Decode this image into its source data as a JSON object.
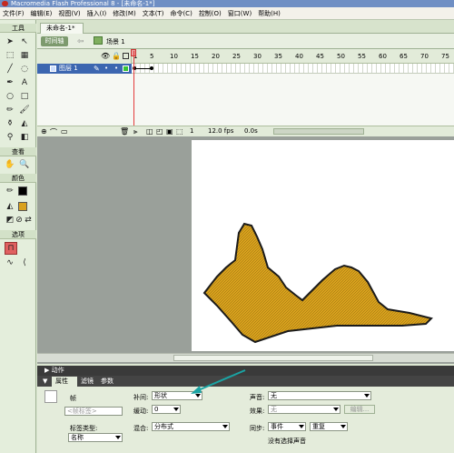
{
  "window": {
    "title": "Macromedia Flash Professional 8 - [未命名-1*]"
  },
  "menu": [
    "文件(F)",
    "编辑(E)",
    "视图(V)",
    "插入(I)",
    "修改(M)",
    "文本(T)",
    "命令(C)",
    "控制(O)",
    "窗口(W)",
    "帮助(H)"
  ],
  "tools_panel": {
    "title": "工具",
    "view_title": "查看",
    "colors_title": "颜色",
    "options_title": "选项"
  },
  "document": {
    "tab": "未命名-1*",
    "timeline_button": "时间轴",
    "scene": "场景 1"
  },
  "timeline": {
    "layer_name": "图层 1",
    "frame_numbers": [
      "1",
      "5",
      "10",
      "15",
      "20",
      "25",
      "30",
      "35",
      "40",
      "45",
      "50",
      "55",
      "60",
      "65",
      "70",
      "75"
    ],
    "current_frame": "1",
    "fps": "12.0 fps",
    "time": "0.0s"
  },
  "stage": {
    "shape_fill": "#d9a11d",
    "shape_stroke": "#1a1a1a"
  },
  "panels": {
    "actions": "动作",
    "properties": "属性",
    "filters": "滤镜",
    "parameters": "参数"
  },
  "properties": {
    "frame_label": "帧",
    "frame_label_placeholder": "<帧标签>",
    "label_type_label": "标签类型:",
    "label_type_value": "名称",
    "tween_label": "补间:",
    "tween_value": "形状",
    "ease_label": "缓动:",
    "ease_value": "0",
    "blend_label": "混合:",
    "blend_value": "分布式",
    "sound_label": "声音:",
    "sound_value": "无",
    "effect_label": "效果:",
    "effect_value": "无",
    "edit_button": "编辑...",
    "sync_label": "同步:",
    "sync_value": "事件",
    "repeat_value": "重复",
    "no_sound_text": "没有选择声音"
  },
  "colors": {
    "accent": "#3c66b0",
    "stage_bg": "#ffffff",
    "panel_bg": "#e4ecdb",
    "arrow": "#1aa3a3"
  }
}
